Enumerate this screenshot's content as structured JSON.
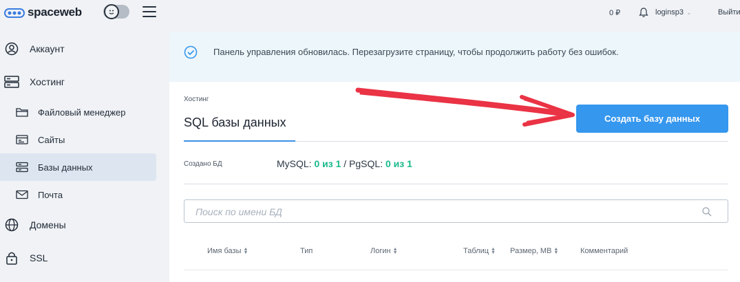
{
  "header": {
    "logo_text": "spaceweb",
    "balance": "0 ₽",
    "username": "loginsp3",
    "logout": "Выйти"
  },
  "sidebar": {
    "items": [
      {
        "label": "Аккаунт",
        "icon": "account-icon"
      },
      {
        "label": "Хостинг",
        "icon": "server-icon"
      },
      {
        "label": "Файловый менеджер",
        "icon": "folder-icon"
      },
      {
        "label": "Сайты",
        "icon": "sites-icon"
      },
      {
        "label": "Базы данных",
        "icon": "database-icon",
        "active": true
      },
      {
        "label": "Почта",
        "icon": "mail-icon"
      },
      {
        "label": "Домены",
        "icon": "globe-icon"
      },
      {
        "label": "SSL",
        "icon": "lock-icon"
      }
    ]
  },
  "notice": {
    "text": "Панель управления обновилась. Перезагрузите страницу, чтобы продолжить работу без ошибок."
  },
  "page": {
    "breadcrumb": "Хостинг",
    "title": "SQL базы данных",
    "create_button": "Создать базу данных"
  },
  "stats": {
    "label": "Создано БД",
    "mysql_label": "MySQL:",
    "mysql_value": "0 из 1",
    "separator": "/",
    "pgsql_label": "PgSQL:",
    "pgsql_value": "0 из 1"
  },
  "search": {
    "placeholder": "Поиск по имени БД"
  },
  "table": {
    "columns": [
      "Имя базы",
      "Тип",
      "Логин",
      "Таблиц",
      "Размер, MB",
      "Комментарий"
    ]
  },
  "colors": {
    "accent": "#3597ee",
    "success": "#1ab98b",
    "annotation_arrow": "#e8182c"
  }
}
